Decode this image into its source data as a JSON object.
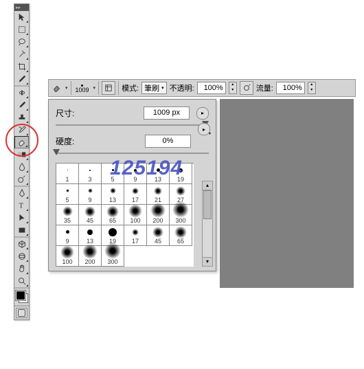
{
  "toolbox": {
    "tools": [
      "move",
      "marquee",
      "lasso",
      "wand",
      "crop",
      "eyedropper",
      "heal",
      "brush",
      "stamp",
      "history-brush",
      "eraser",
      "gradient",
      "blur",
      "dodge",
      "pen",
      "type",
      "path-select",
      "rectangle",
      "hand",
      "zoom",
      "rotate-view",
      "3d-object",
      "3d-camera"
    ]
  },
  "options": {
    "tool_icon": "eraser-icon",
    "brush_size_preview": 1009,
    "mode_label": "模式:",
    "mode_value": "筆刷",
    "opacity_label": "不透明:",
    "opacity_value": "100%",
    "flow_label": "流量:",
    "flow_value": "100%"
  },
  "brush_panel": {
    "size_label": "尺寸:",
    "size_value": "1009 px",
    "hardness_label": "硬度:",
    "hardness_value": "0%",
    "slider_size_pos": 100,
    "slider_hard_pos": 0,
    "presets": [
      {
        "label": "1",
        "type": "hard",
        "d": 1
      },
      {
        "label": "3",
        "type": "hard",
        "d": 2
      },
      {
        "label": "5",
        "type": "hard",
        "d": 3
      },
      {
        "label": "9",
        "type": "hard",
        "d": 4
      },
      {
        "label": "13",
        "type": "hard",
        "d": 5
      },
      {
        "label": "19",
        "type": "hard",
        "d": 6
      },
      {
        "label": "5",
        "type": "soft",
        "d": 5
      },
      {
        "label": "9",
        "type": "soft",
        "d": 7
      },
      {
        "label": "13",
        "type": "soft",
        "d": 9
      },
      {
        "label": "17",
        "type": "soft",
        "d": 10
      },
      {
        "label": "21",
        "type": "soft",
        "d": 12
      },
      {
        "label": "27",
        "type": "soft",
        "d": 14
      },
      {
        "label": "35",
        "type": "soft",
        "d": 15
      },
      {
        "label": "45",
        "type": "soft",
        "d": 16
      },
      {
        "label": "65",
        "type": "soft",
        "d": 18
      },
      {
        "label": "100",
        "type": "soft",
        "d": 20
      },
      {
        "label": "200",
        "type": "soft",
        "d": 22
      },
      {
        "label": "300",
        "type": "soft",
        "d": 24
      },
      {
        "label": "9",
        "type": "hard",
        "d": 5
      },
      {
        "label": "13",
        "type": "hard",
        "d": 8
      },
      {
        "label": "19",
        "type": "hard",
        "d": 12
      },
      {
        "label": "17",
        "type": "soft",
        "d": 10
      },
      {
        "label": "45",
        "type": "soft",
        "d": 16
      },
      {
        "label": "65",
        "type": "soft",
        "d": 18
      },
      {
        "label": "100",
        "type": "soft",
        "d": 20
      },
      {
        "label": "200",
        "type": "soft",
        "d": 22
      },
      {
        "label": "300",
        "type": "soft",
        "d": 24
      }
    ]
  },
  "watermark": "125194"
}
